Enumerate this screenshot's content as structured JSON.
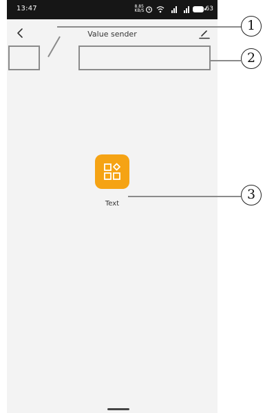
{
  "status_bar": {
    "time": "13:47",
    "net_speed": "8.85 KB/S",
    "battery": "63"
  },
  "header": {
    "title": "Value sender"
  },
  "widget": {
    "label": "Text"
  },
  "callouts": [
    "1",
    "2",
    "3"
  ],
  "colors": {
    "status_bar": "#161616",
    "background": "#f3f3f3",
    "widget_accent": "#f5a314",
    "callout_line": "#8a8a8a"
  },
  "icons": [
    "back-chevron",
    "edit-pencil",
    "alarm",
    "wifi",
    "signal",
    "battery",
    "shapes"
  ]
}
